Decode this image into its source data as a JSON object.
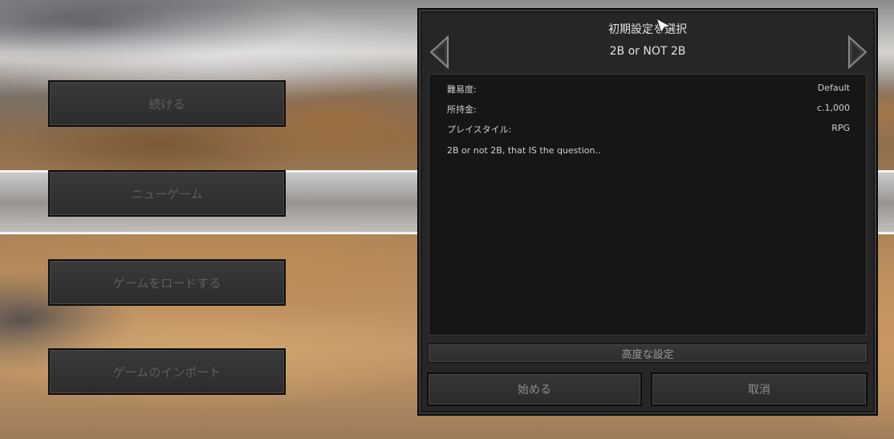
{
  "menu": {
    "continue_label": "続ける",
    "new_game_label": "ニューゲーム",
    "load_game_label": "ゲームをロードする",
    "import_game_label": "ゲームのインポート"
  },
  "dialog": {
    "title": "初期設定を選択",
    "preset_name": "2B or NOT 2B",
    "details": [
      {
        "label": "難易度",
        "value": "Default"
      },
      {
        "label": "所持金",
        "value": "c.1,000"
      },
      {
        "label": "プレイスタイル",
        "value": "RPG"
      }
    ],
    "description": "2B or not 2B, that IS the question..",
    "advanced_label": "高度な設定",
    "start_label": "始める",
    "cancel_label": "取消"
  },
  "icons": {
    "prev": "triangle-left-icon",
    "next": "triangle-right-icon",
    "cursor": "mouse-cursor-icon"
  },
  "colors": {
    "panel_bg": "#262626",
    "inner_panel_bg": "#161616",
    "text": "#e2e2e2",
    "disabled_text": "#5e5e5e"
  }
}
